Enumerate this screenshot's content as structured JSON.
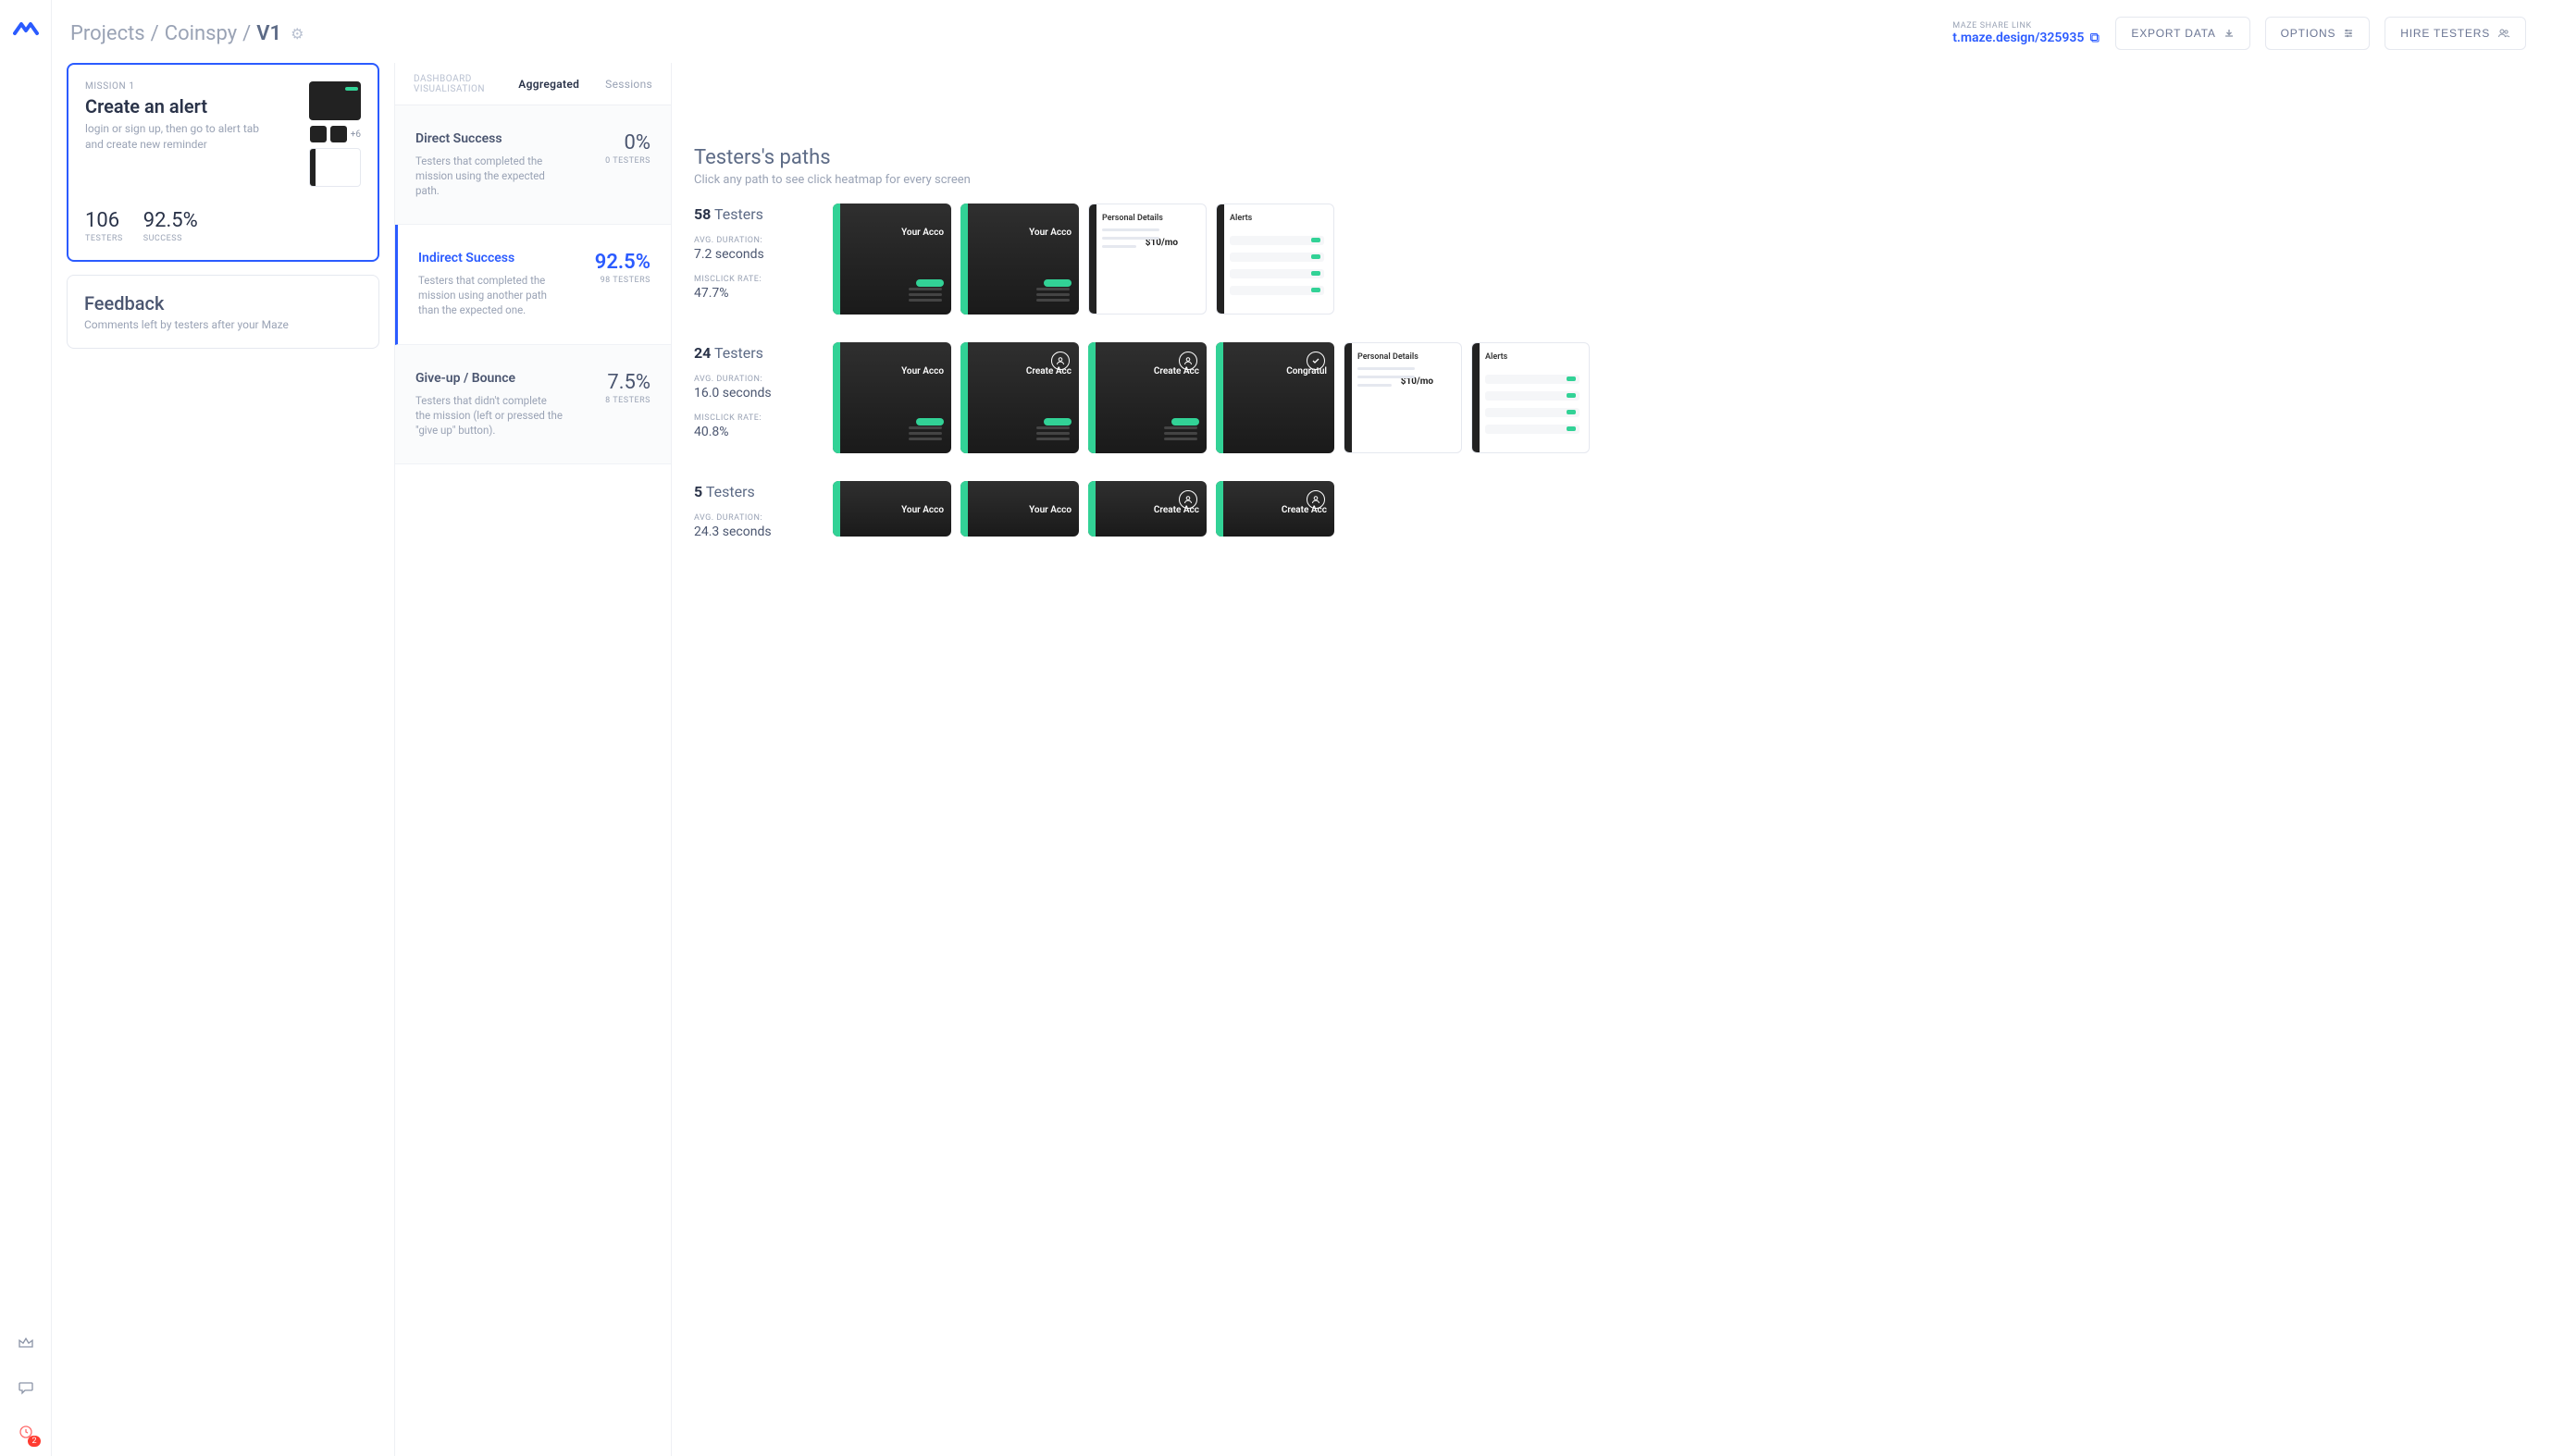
{
  "breadcrumb": {
    "projects": "Projects",
    "project": "Coinspy",
    "version": "V1",
    "sep": "/"
  },
  "share": {
    "label": "MAZE SHARE LINK",
    "url": "t.maze.design/325935"
  },
  "buttons": {
    "export": "EXPORT DATA",
    "options": "OPTIONS",
    "hire": "HIRE TESTERS"
  },
  "mission": {
    "label": "MISSION 1",
    "title": "Create an alert",
    "desc": "login or sign up, then go to alert tab and create new reminder",
    "thumb_more": "+6",
    "testers_value": "106",
    "testers_label": "TESTERS",
    "success_value": "92.5%",
    "success_label": "SUCCESS"
  },
  "feedback": {
    "title": "Feedback",
    "desc": "Comments left by testers after your Maze"
  },
  "tabs": {
    "label": "DASHBOARD VISUALISATION",
    "aggregated": "Aggregated",
    "sessions": "Sessions"
  },
  "metrics": {
    "direct": {
      "title": "Direct Success",
      "desc": "Testers that completed the mission using the expected path.",
      "pct": "0%",
      "sub": "0 TESTERS"
    },
    "indirect": {
      "title": "Indirect Success",
      "desc": "Testers that completed the mission using another path than the expected one.",
      "pct": "92.5%",
      "sub": "98 TESTERS"
    },
    "giveup": {
      "title": "Give-up / Bounce",
      "desc": "Testers that didn't complete the mission (left or pressed the \"give up\" button).",
      "pct": "7.5%",
      "sub": "8 TESTERS"
    }
  },
  "paths": {
    "title": "Testers's paths",
    "subtitle": "Click any path to see click heatmap for every screen",
    "testers_word": "Testers",
    "avg_label": "AVG. DURATION:",
    "mis_label": "MISCLICK RATE:",
    "groups": [
      {
        "count": "58",
        "duration": "7.2 seconds",
        "misclick": "47.7%"
      },
      {
        "count": "24",
        "duration": "16.0 seconds",
        "misclick": "40.8%"
      },
      {
        "count": "5",
        "duration": "24.3 seconds",
        "misclick": ""
      }
    ]
  },
  "screen_labels": {
    "your_account": "Your Acco",
    "create_account": "Create Acc",
    "congrat": "Congratul",
    "personal": "Personal Details",
    "alerts": "Alerts",
    "price": "$10/mo"
  },
  "rail": {
    "badge": "2"
  }
}
